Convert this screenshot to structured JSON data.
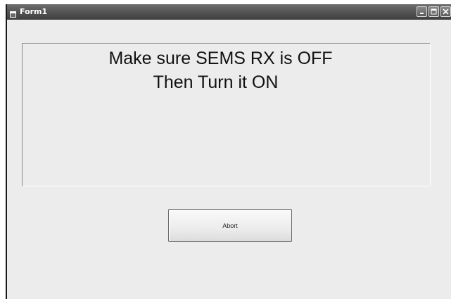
{
  "window": {
    "title": "Form1",
    "controls": {
      "minimize_icon": "minimize-icon",
      "maximize_icon": "maximize-icon",
      "close_icon": "close-icon"
    }
  },
  "message": {
    "line1": "Make sure SEMS RX is OFF",
    "line2": "Then Turn it ON"
  },
  "buttons": {
    "abort_label": "Abort"
  },
  "colors": {
    "titlebar": "#555555",
    "client": "#ececec",
    "text": "#111111"
  }
}
